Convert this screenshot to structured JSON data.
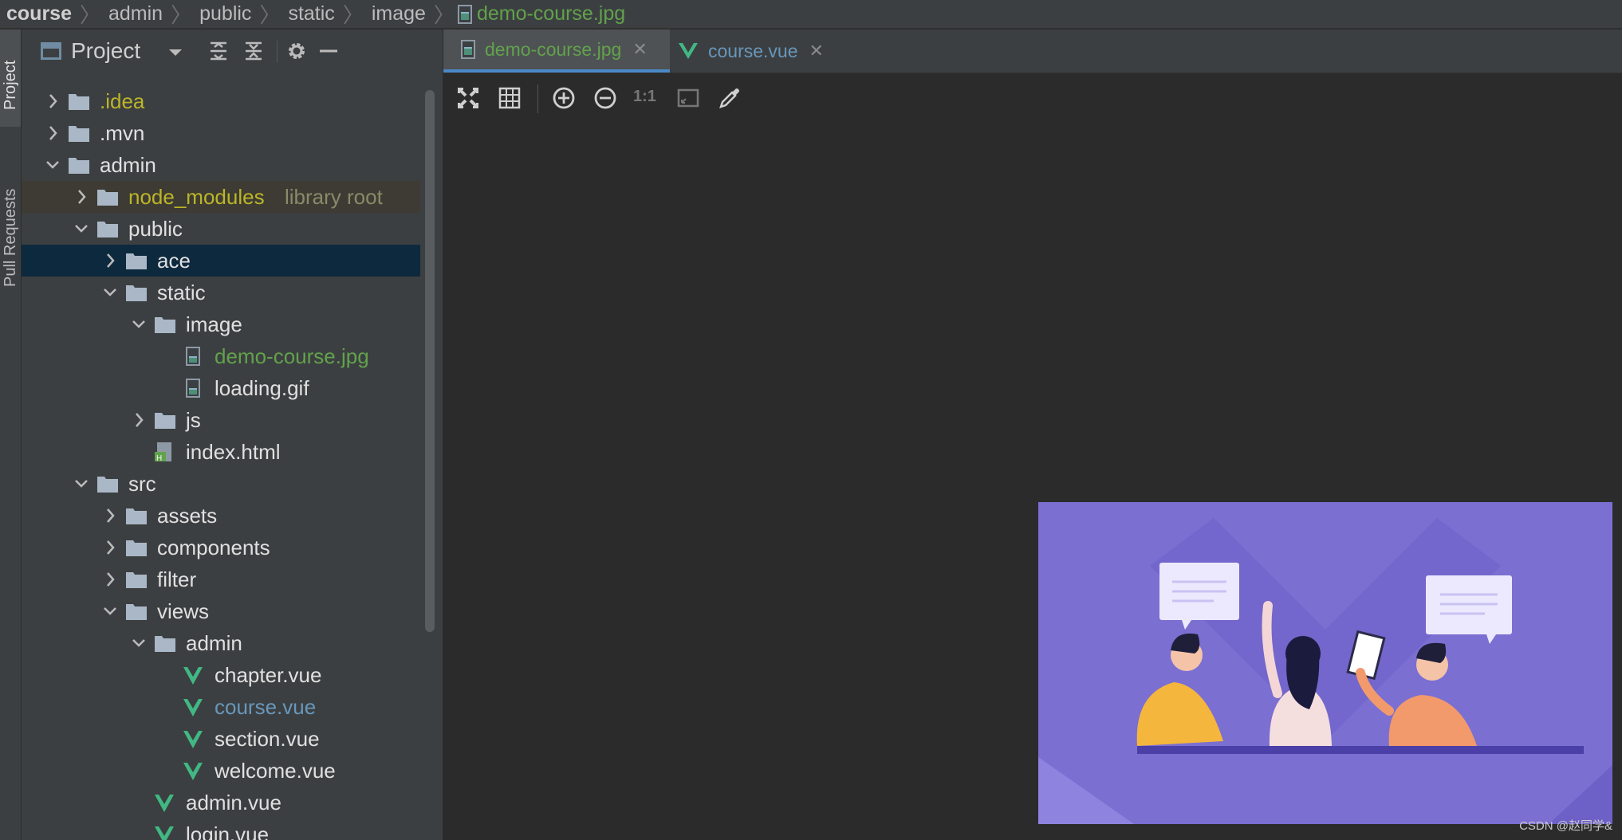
{
  "breadcrumb": {
    "items": [
      "course",
      "admin",
      "public",
      "static",
      "image"
    ],
    "file": "demo-course.jpg"
  },
  "tool_stripe": {
    "project_label": "Project",
    "pull_requests_label": "Pull Requests"
  },
  "project_panel": {
    "title": "Project"
  },
  "tree": [
    {
      "label": ".idea",
      "type": "folder",
      "depth": 1,
      "expanded": false,
      "color": "yellow"
    },
    {
      "label": ".mvn",
      "type": "folder",
      "depth": 1,
      "expanded": false,
      "color": "white"
    },
    {
      "label": "admin",
      "type": "folder",
      "depth": 1,
      "expanded": true,
      "color": "white"
    },
    {
      "label": "node_modules",
      "extra": "library root",
      "type": "folder",
      "depth": 2,
      "expanded": false,
      "color": "yellow",
      "highlight": true
    },
    {
      "label": "public",
      "type": "folder",
      "depth": 2,
      "expanded": true,
      "color": "white"
    },
    {
      "label": "ace",
      "type": "folder",
      "depth": 3,
      "expanded": false,
      "color": "white",
      "selected": true
    },
    {
      "label": "static",
      "type": "folder",
      "depth": 3,
      "expanded": true,
      "color": "white"
    },
    {
      "label": "image",
      "type": "folder",
      "depth": 4,
      "expanded": true,
      "color": "white"
    },
    {
      "label": "demo-course.jpg",
      "type": "image",
      "depth": 5,
      "color": "green"
    },
    {
      "label": "loading.gif",
      "type": "image",
      "depth": 5,
      "color": "white"
    },
    {
      "label": "js",
      "type": "folder",
      "depth": 4,
      "expanded": false,
      "color": "white"
    },
    {
      "label": "index.html",
      "type": "html",
      "depth": 4,
      "color": "white"
    },
    {
      "label": "src",
      "type": "folder",
      "depth": 2,
      "expanded": true,
      "color": "white"
    },
    {
      "label": "assets",
      "type": "folder",
      "depth": 3,
      "expanded": false,
      "color": "white"
    },
    {
      "label": "components",
      "type": "folder",
      "depth": 3,
      "expanded": false,
      "color": "white"
    },
    {
      "label": "filter",
      "type": "folder",
      "depth": 3,
      "expanded": false,
      "color": "white"
    },
    {
      "label": "views",
      "type": "folder",
      "depth": 3,
      "expanded": true,
      "color": "white"
    },
    {
      "label": "admin",
      "type": "folder",
      "depth": 4,
      "expanded": true,
      "color": "white"
    },
    {
      "label": "chapter.vue",
      "type": "vue",
      "depth": 5,
      "color": "white"
    },
    {
      "label": "course.vue",
      "type": "vue",
      "depth": 5,
      "color": "blue"
    },
    {
      "label": "section.vue",
      "type": "vue",
      "depth": 5,
      "color": "white"
    },
    {
      "label": "welcome.vue",
      "type": "vue",
      "depth": 5,
      "color": "white"
    },
    {
      "label": "admin.vue",
      "type": "vue",
      "depth": 4,
      "color": "white"
    },
    {
      "label": "login.vue",
      "type": "vue",
      "depth": 4,
      "color": "white"
    }
  ],
  "tabs": [
    {
      "label": "demo-course.jpg",
      "active": true,
      "close": "✕"
    },
    {
      "label": "course.vue",
      "active": false,
      "close": "✕"
    }
  ],
  "image_toolbar": {
    "actual_size_label": "1:1"
  },
  "colors": {
    "accent": "#4a88c7",
    "vue_green": "#41b883",
    "file_green": "#62a24c",
    "folder_yellow": "#bbb529",
    "preview_bg": "#7b6fd2"
  },
  "watermark": "CSDN @赵同学&"
}
